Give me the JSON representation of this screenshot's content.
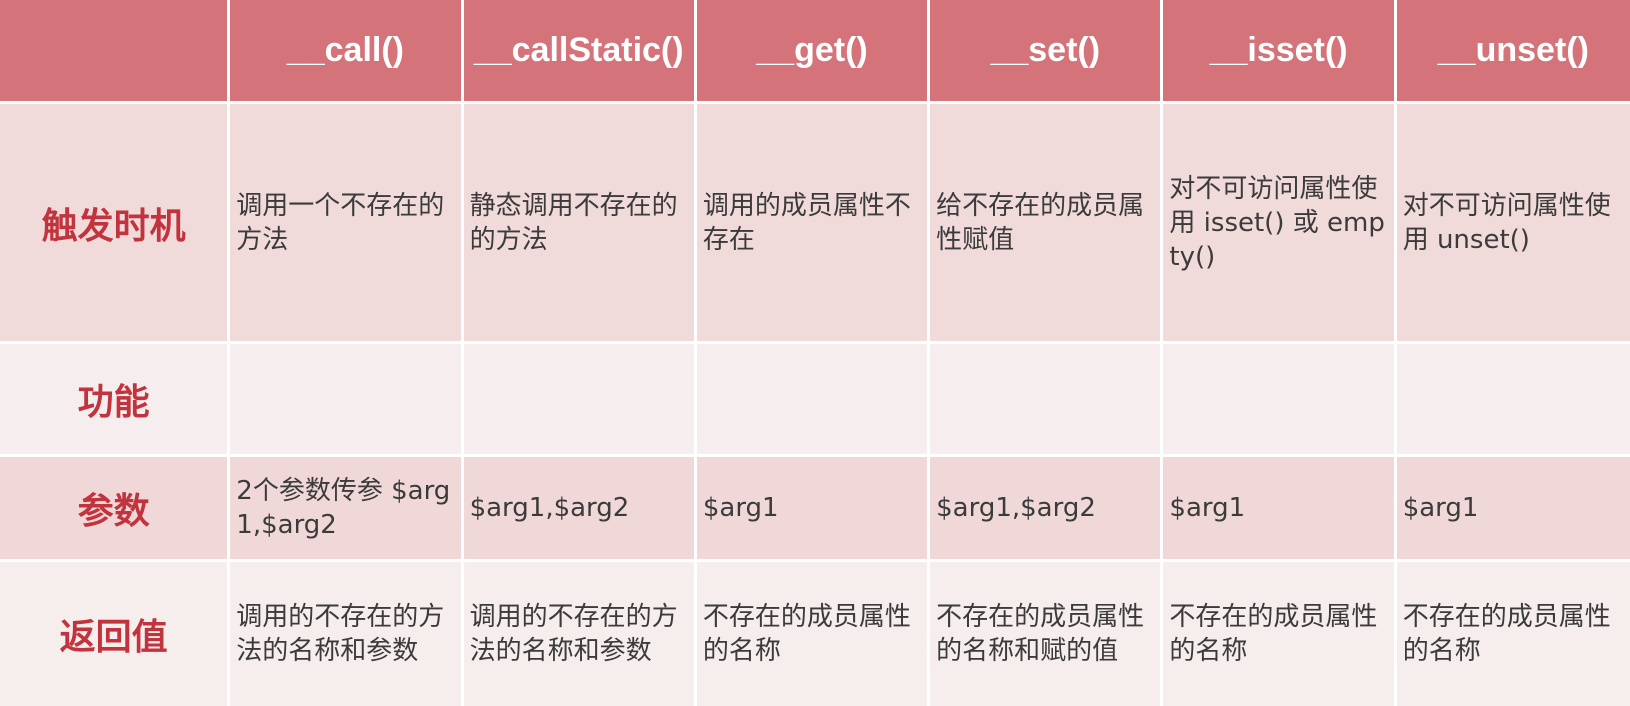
{
  "table": {
    "columns": [
      "__call()",
      "__callStatic()",
      "__get()",
      "__set()",
      "__isset()",
      "__unset()"
    ],
    "rows": [
      {
        "label": "触发时机",
        "cells": [
          "调用一个不存在的方法",
          "静态调用不存在的的方法",
          "调用的成员属性不存在",
          "给不存在的成员属性赋值",
          "对不可访问属性使用 isset() 或 empty()",
          "对不可访问属性使用 unset()"
        ]
      },
      {
        "label": "功能",
        "cells": [
          "",
          "",
          "",
          "",
          "",
          ""
        ]
      },
      {
        "label": "参数",
        "cells": [
          "2个参数传参 $arg1,$arg2",
          "$arg1,$arg2",
          "$arg1",
          "$arg1,$arg2",
          "$arg1",
          "$arg1"
        ]
      },
      {
        "label": "返回值",
        "cells": [
          "调用的不存在的方法的名称和参数",
          "调用的不存在的方法的名称和参数",
          "不存在的成员属性的名称",
          "不存在的成员属性的名称和赋的值",
          "不存在的成员属性的名称",
          "不存在的成员属性的名称"
        ]
      }
    ]
  },
  "colors": {
    "header_bg": "#d4747a",
    "header_text": "#ffffff",
    "row_label_text": "#c2343d",
    "cell_text": "#3b3b3b"
  }
}
